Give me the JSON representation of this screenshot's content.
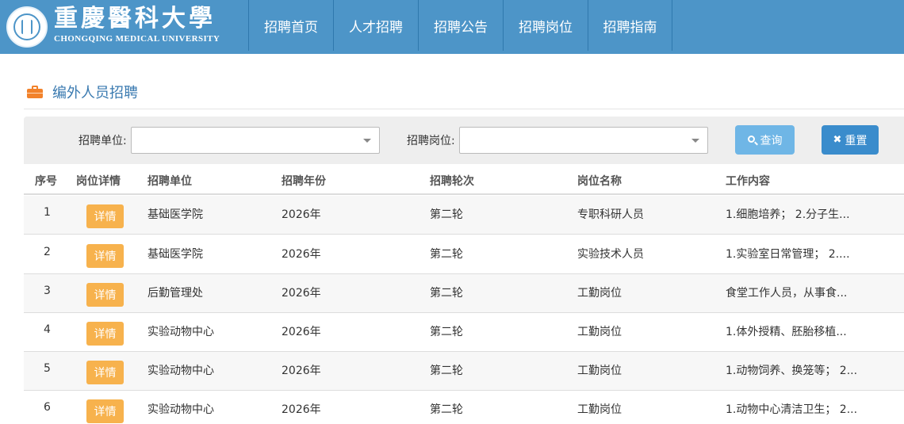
{
  "header": {
    "logo_cn": "重慶醫科大學",
    "logo_en": "CHONGQING MEDICAL UNIVERSITY",
    "nav": [
      "招聘首页",
      "人才招聘",
      "招聘公告",
      "招聘岗位",
      "招聘指南"
    ],
    "color": "#4d95c8"
  },
  "section": {
    "title": "编外人员招聘",
    "icon": "briefcase-icon"
  },
  "filter": {
    "unit_label": "招聘单位:",
    "unit_value": "",
    "position_label": "招聘岗位:",
    "position_value": "",
    "search_label": "查询",
    "reset_label": "重置"
  },
  "table": {
    "headers": [
      "序号",
      "岗位详情",
      "招聘单位",
      "招聘年份",
      "招聘轮次",
      "岗位名称",
      "工作内容"
    ],
    "detail_label": "详情",
    "rows": [
      {
        "no": "1",
        "unit": "基础医学院",
        "year": "2026年",
        "round": "第二轮",
        "position": "专职科研人员",
        "content": "1.细胞培养； 2.分子生..."
      },
      {
        "no": "2",
        "unit": "基础医学院",
        "year": "2026年",
        "round": "第二轮",
        "position": "实验技术人员",
        "content": "1.实验室日常管理； 2...."
      },
      {
        "no": "3",
        "unit": "后勤管理处",
        "year": "2026年",
        "round": "第二轮",
        "position": "工勤岗位",
        "content": "食堂工作人员，从事食..."
      },
      {
        "no": "4",
        "unit": "实验动物中心",
        "year": "2026年",
        "round": "第二轮",
        "position": "工勤岗位",
        "content": "1.体外授精、胚胎移植..."
      },
      {
        "no": "5",
        "unit": "实验动物中心",
        "year": "2026年",
        "round": "第二轮",
        "position": "工勤岗位",
        "content": "1.动物饲养、换笼等； 2..."
      },
      {
        "no": "6",
        "unit": "实验动物中心",
        "year": "2026年",
        "round": "第二轮",
        "position": "工勤岗位",
        "content": "1.动物中心清洁卫生； 2..."
      }
    ]
  },
  "colors": {
    "accent": "#f7b24d",
    "search": "#6fb6e6",
    "reset": "#3a8ccc",
    "title": "#3a7ab0"
  }
}
